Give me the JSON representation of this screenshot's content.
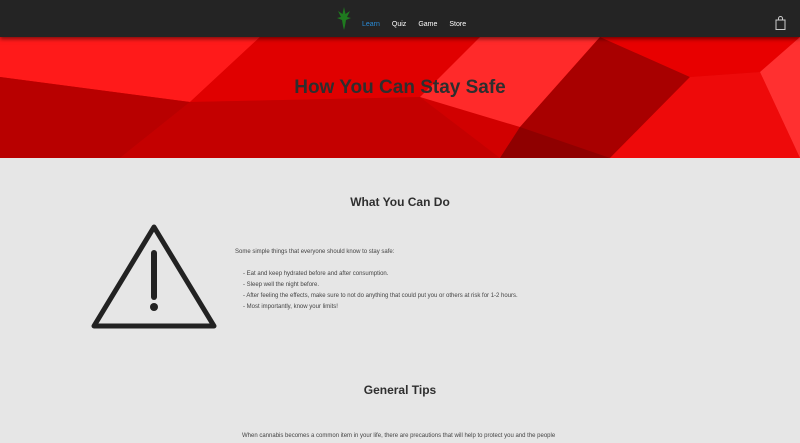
{
  "nav": {
    "links": [
      "Learn",
      "Quiz",
      "Game",
      "Store"
    ],
    "active_index": 0,
    "logo_icon": "cannabis-leaf-icon",
    "cart_icon": "shopping-bag-icon"
  },
  "hero": {
    "title": "How You Can Stay Safe"
  },
  "what_you_can_do": {
    "heading": "What You Can Do",
    "icon": "warning-triangle-icon",
    "intro": "Some simple things that everyone should know to stay safe:",
    "tips": [
      "- Eat and keep hydrated before and after consumption.",
      "- Sleep well the night before.",
      "- After feeling the effects, make sure to not do anything that could put you or others at risk for 1-2 hours.",
      "- Most importantly, know your limits!"
    ]
  },
  "general_tips": {
    "heading": "General Tips",
    "text": "When cannabis becomes a common item in your life, there are precautions that will help to protect you and the people"
  },
  "colors": {
    "navbar": "#242424",
    "active_link": "#2a8cd8",
    "hero_red": "#d40000",
    "page_bg": "#e6e6e6"
  }
}
